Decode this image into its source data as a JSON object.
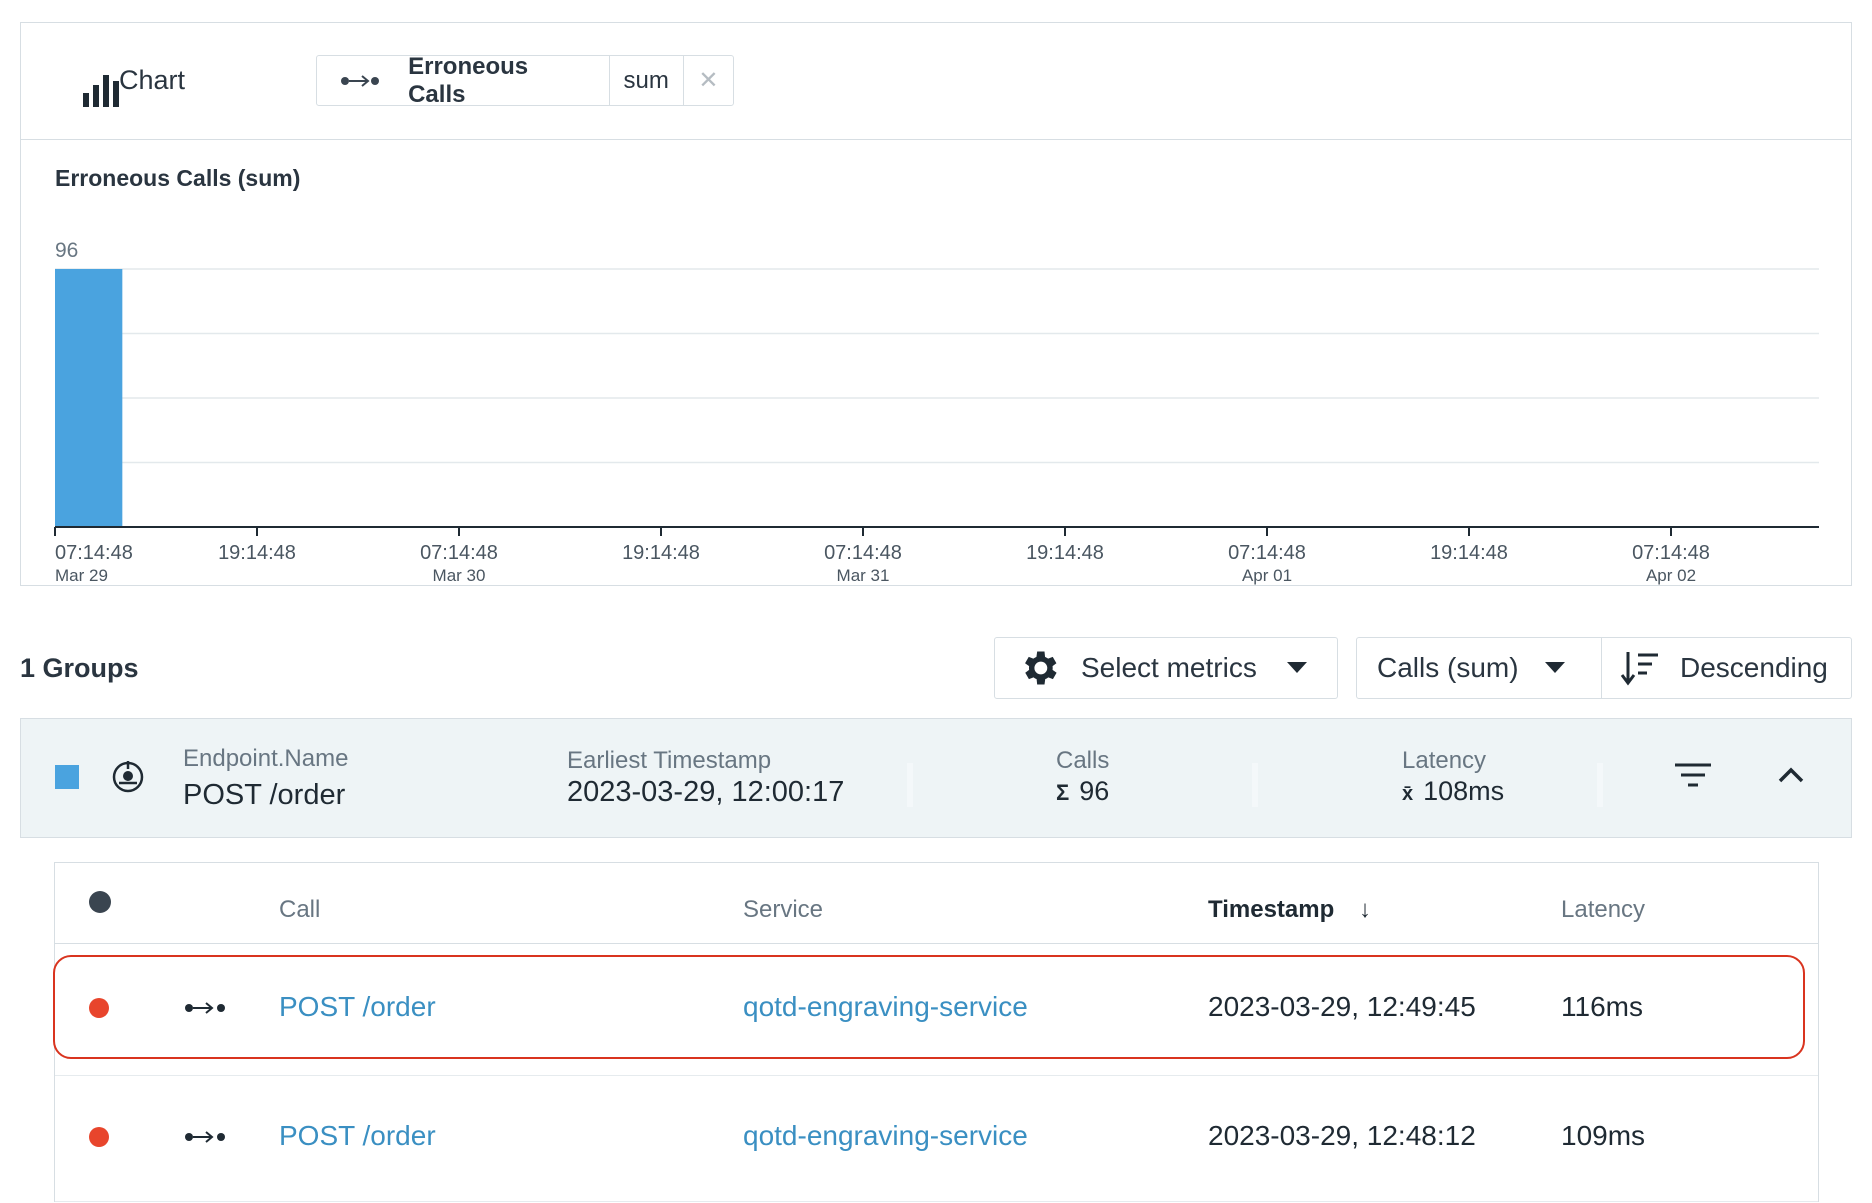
{
  "chart": {
    "header_title": "Chart",
    "metric": {
      "name": "Erroneous Calls",
      "aggregation": "sum",
      "icon": "call-flow-icon"
    },
    "remove_icon": "close-icon",
    "header_icon": "bar-chart-icon"
  },
  "chart_data": {
    "type": "bar",
    "title": "Erroneous Calls (sum)",
    "ylim": [
      0,
      96
    ],
    "y_tick_label": "96",
    "grid": true,
    "color": "#4aa3df",
    "x_ticks": [
      {
        "time": "07:14:48",
        "date": "Mar 29"
      },
      {
        "time": "19:14:48",
        "date": ""
      },
      {
        "time": "07:14:48",
        "date": "Mar 30"
      },
      {
        "time": "19:14:48",
        "date": ""
      },
      {
        "time": "07:14:48",
        "date": "Mar 31"
      },
      {
        "time": "19:14:48",
        "date": ""
      },
      {
        "time": "07:14:48",
        "date": "Apr 01"
      },
      {
        "time": "19:14:48",
        "date": ""
      },
      {
        "time": "07:14:48",
        "date": "Apr 02"
      }
    ],
    "bars": [
      {
        "start": "2023-03-29T07:14:48",
        "end": "2023-03-29T11:14:48",
        "value": 96
      }
    ]
  },
  "groups": {
    "title": "1 Groups",
    "select_metrics_label": "Select metrics",
    "sort_metric_label": "Calls (sum)",
    "sort_order_label": "Descending"
  },
  "group": {
    "color": "#4aa3df",
    "endpoint_label": "Endpoint.Name",
    "endpoint_value": "POST /order",
    "earliest_label": "Earliest Timestamp",
    "earliest_value": "2023-03-29, 12:00:17",
    "calls_label": "Calls",
    "calls_prefix": "Σ",
    "calls_value": "96",
    "latency_label": "Latency",
    "latency_prefix": "x̄",
    "latency_value": "108ms"
  },
  "table": {
    "columns": {
      "call": "Call",
      "service": "Service",
      "timestamp": "Timestamp",
      "latency": "Latency"
    },
    "rows": [
      {
        "call": "POST /order",
        "service": "qotd-engraving-service",
        "timestamp": "2023-03-29, 12:49:45",
        "latency": "116ms",
        "status_color": "#e8452c",
        "highlighted": true
      },
      {
        "call": "POST /order",
        "service": "qotd-engraving-service",
        "timestamp": "2023-03-29, 12:48:12",
        "latency": "109ms",
        "status_color": "#e8452c",
        "highlighted": false
      }
    ]
  },
  "colors": {
    "accent": "#3a8fc2",
    "error": "#e8452c",
    "highlight_border": "#d9341f"
  }
}
